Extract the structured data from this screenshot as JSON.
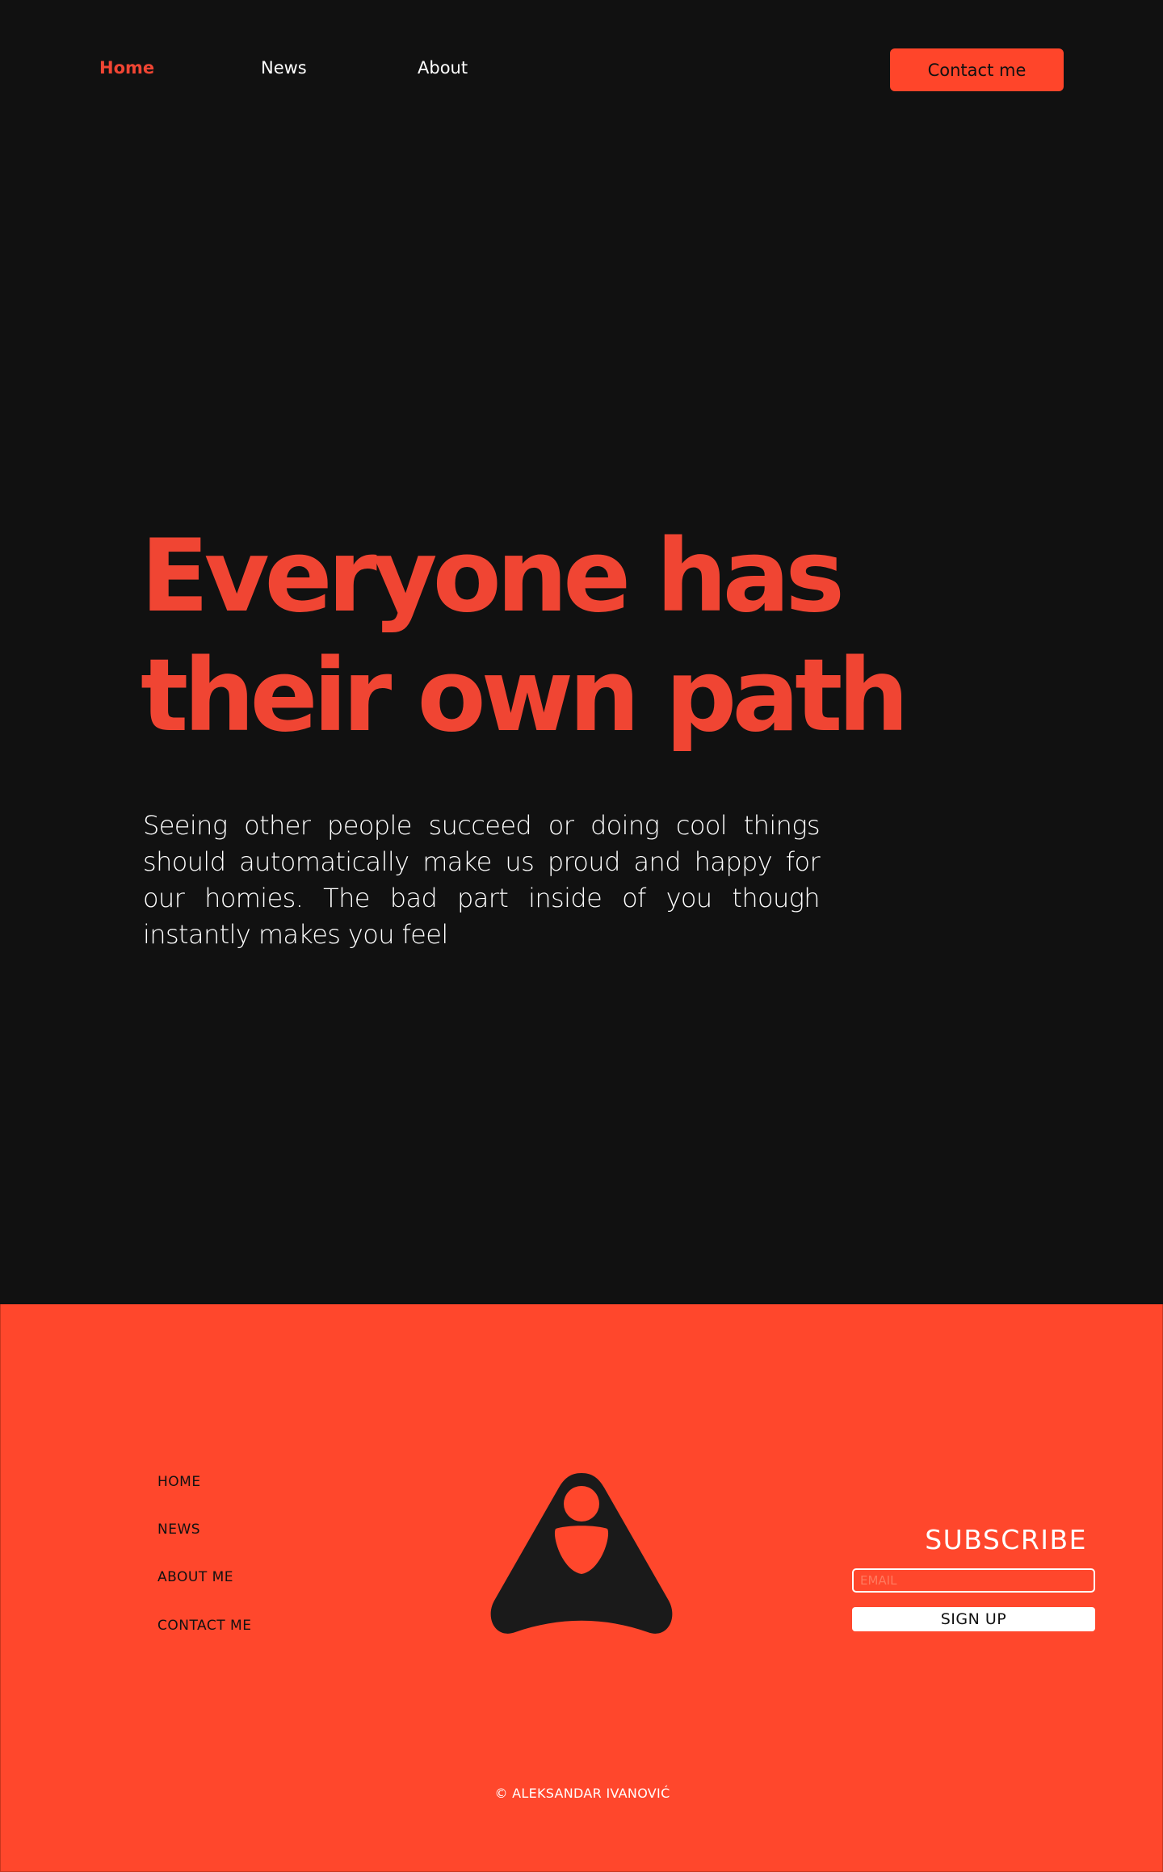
{
  "nav": {
    "home": "Home",
    "news": "News",
    "about": "About",
    "contact_button": "Contact me"
  },
  "hero": {
    "title_line1": "Everyone has",
    "title_line2": "their own path",
    "text": "Seeing other people succeed or doing cool things should automatically make us proud and happy for our homies. The bad part inside of you though instantly makes you feel"
  },
  "footer": {
    "links": [
      "HOME",
      "NEWS",
      "ABOUT ME",
      "CONTACT ME"
    ],
    "subscribe_title": "SUBSCRIBE",
    "email_placeholder": "EMAIL",
    "signup_label": "SIGN UP",
    "copyright": "© ALEKSANDAR IVANOVIĆ"
  },
  "colors": {
    "background": "#111111",
    "accent": "#f04533",
    "footer_background": "#ff472c",
    "logo": "#1a1a1a"
  },
  "icons": {
    "logo": "triangle-person-logo-icon"
  }
}
